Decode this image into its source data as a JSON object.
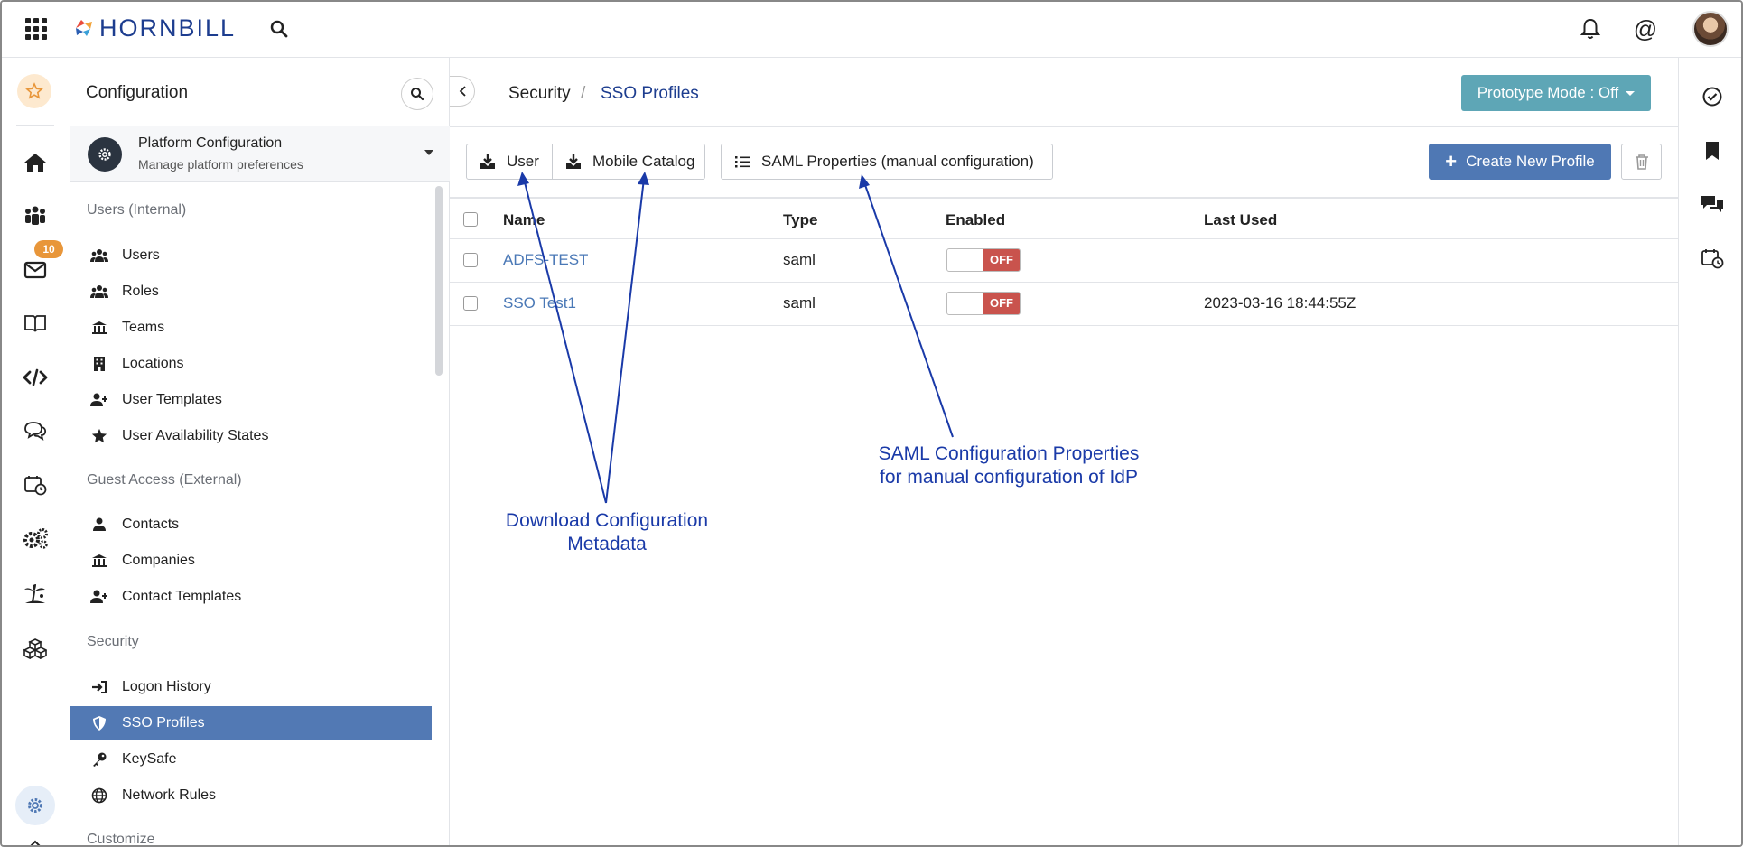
{
  "app": {
    "logo_text": "HORNBILL"
  },
  "nav": {
    "mail_badge": "10"
  },
  "sidebar": {
    "title": "Configuration",
    "platform": {
      "title": "Platform Configuration",
      "subtitle": "Manage platform preferences"
    },
    "sections": [
      {
        "label": "Users (Internal)",
        "items": [
          "Users",
          "Roles",
          "Teams",
          "Locations",
          "User Templates",
          "User Availability States"
        ]
      },
      {
        "label": "Guest Access (External)",
        "items": [
          "Contacts",
          "Companies",
          "Contact Templates"
        ]
      },
      {
        "label": "Security",
        "items": [
          "Logon History",
          "SSO Profiles",
          "KeySafe",
          "Network Rules"
        ]
      },
      {
        "label": "Customize",
        "items": []
      }
    ],
    "active_item": "SSO Profiles"
  },
  "breadcrumb": {
    "parent": "Security",
    "separator": "/",
    "current": "SSO Profiles"
  },
  "prototype_mode": "Prototype Mode : Off",
  "toolbar": {
    "user_btn": "User",
    "mobile_btn": "Mobile Catalog",
    "saml_btn": "SAML Properties (manual configuration)",
    "create_btn": "Create New Profile"
  },
  "table": {
    "columns": [
      "Name",
      "Type",
      "Enabled",
      "Last Used"
    ],
    "rows": [
      {
        "name": "ADFS-TEST",
        "type": "saml",
        "enabled": "OFF",
        "last_used": ""
      },
      {
        "name": "SSO Test1",
        "type": "saml",
        "enabled": "OFF",
        "last_used": "2023-03-16 18:44:55Z"
      }
    ]
  },
  "annotations": {
    "download_line1": "Download Configuration",
    "download_line2": "Metadata",
    "saml_line1": "SAML Configuration Properties",
    "saml_line2": "for manual configuration of IdP"
  },
  "colors": {
    "accent": "#5279b4",
    "brand": "#1d3d8f",
    "annotation": "#1a3aa8",
    "toggle_off": "#c9534d",
    "prototype": "#5ea6b6"
  }
}
